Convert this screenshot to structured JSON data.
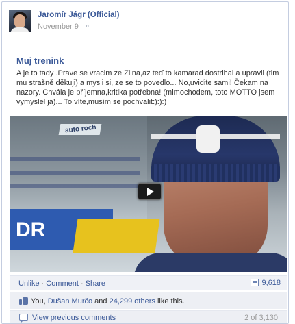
{
  "post": {
    "author": "Jaromír Jágr (Official)",
    "date": "November 9",
    "privacy_icon": "globe-icon",
    "title": "Muj trenink",
    "text": "A je to tady .Prave se vracim ze Zlina,az teď to kamarad dostrihal a upravil (tim mu strašně děkuji) a mysli si, ze se to povedlo... No,uvidite sami! Čekam na nazory. Chvála je příjemna,kritika potřebna! (mimochodem, toto MOTTO jsem vymyslel já)... To víte,musím se pochvalit:):):)",
    "video_sign_text": "auto roch",
    "video_board_text": "DR"
  },
  "actions": {
    "unlike": "Unlike",
    "separator": "·",
    "comment": "Comment",
    "share": "Share",
    "share_count": "9,618"
  },
  "likes": {
    "you": "You,",
    "person": "Dušan Murčo",
    "and": "and",
    "others": "24,299 others",
    "suffix": "like this."
  },
  "comments": {
    "view_previous": "View previous comments",
    "count": "2 of 3,130"
  },
  "colors": {
    "link": "#3b5998",
    "muted": "#999999",
    "panel": "#edeff4",
    "border": "#c4cde0"
  }
}
